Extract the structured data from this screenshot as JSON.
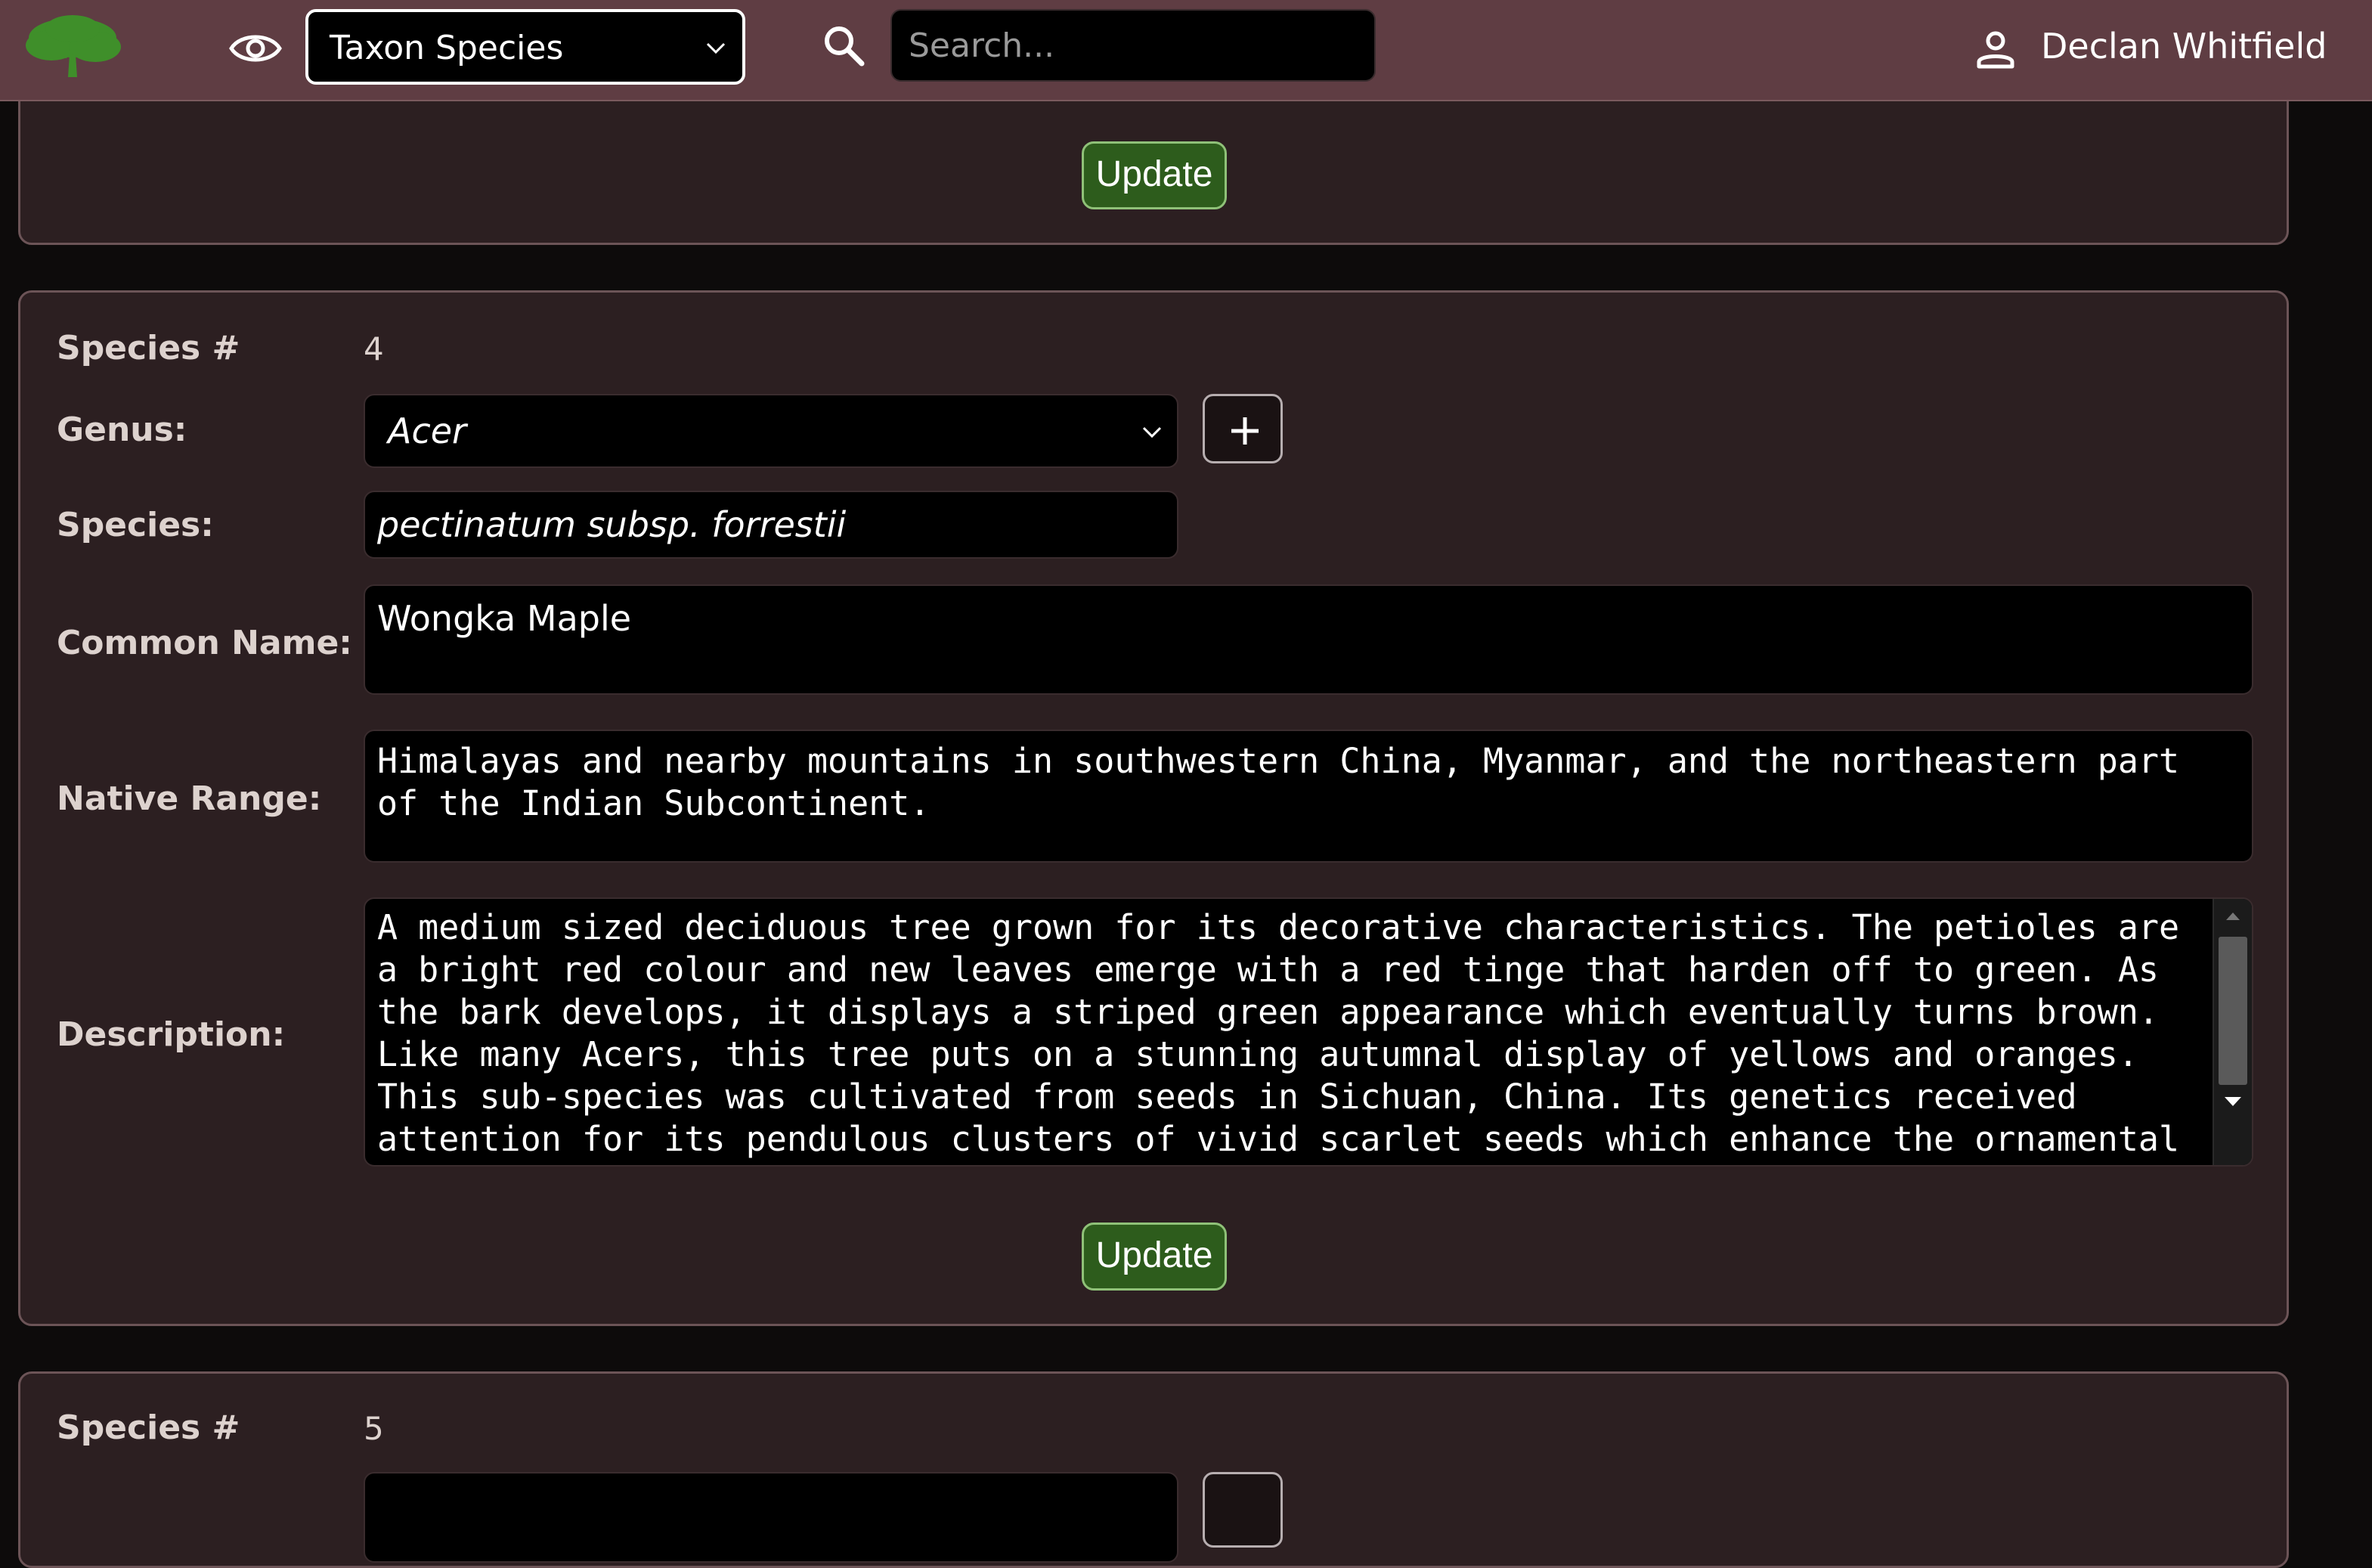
{
  "header": {
    "taxon_select": "Taxon Species",
    "search_placeholder": "Search...",
    "user_name": "Declan Whitfield"
  },
  "cards": [
    {
      "update_label": "Update"
    },
    {
      "species_num_label": "Species #",
      "species_num": "4",
      "genus_label": "Genus:",
      "genus": "Acer",
      "species_label": "Species:",
      "species": "pectinatum subsp. forrestii",
      "common_label": "Common Name:",
      "common_name": "Wongka Maple",
      "native_label": "Native Range:",
      "native_range": "Himalayas and nearby mountains in southwestern China, Myanmar, and the northeastern part of the Indian Subcontinent.",
      "description_label": "Description:",
      "description": "A medium sized deciduous tree grown for its decorative characteristics. The petioles are a bright red colour and new leaves emerge with a red tinge that harden off to green. As the bark develops, it displays a striped green appearance which eventually turns brown. Like many Acers, this tree puts on a stunning autumnal display of yellows and oranges. This sub-species was cultivated from seeds in Sichuan, China. Its genetics received attention for its pendulous clusters of vivid scarlet seeds which enhance the ornamental value.",
      "update_label": "Update"
    },
    {
      "species_num_label": "Species #",
      "species_num": "5"
    }
  ]
}
